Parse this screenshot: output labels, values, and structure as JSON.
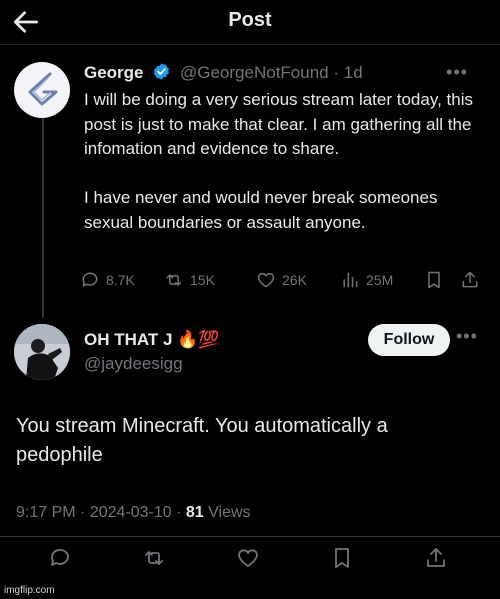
{
  "header": {
    "title": "Post"
  },
  "quoted_post": {
    "author_name": "George",
    "handle": "@GeorgeNotFound",
    "time": "· 1d",
    "text": "I will be doing a very serious stream later today, this post is just to make that clear. I am gathering all the infomation and evidence to share.\n\nI have never and would never break someones sexual boundaries or assault anyone.",
    "stats": {
      "replies": "8.7K",
      "reposts": "15K",
      "likes": "26K",
      "views": "25M"
    }
  },
  "reply_post": {
    "author_name": "OH THAT J 🔥💯",
    "handle": "@jaydeesigg",
    "follow_label": "Follow",
    "text": "You stream Minecraft. You automatically a pedophile",
    "time": "9:17 PM",
    "date": "2024-03-10",
    "views_count": "81",
    "views_label": "Views",
    "separator": "·"
  },
  "watermark": "imgflip.com",
  "colors": {
    "background": "#000000",
    "text": "#e7e9ea",
    "muted": "#71767b",
    "verified": "#1d9bf0"
  }
}
